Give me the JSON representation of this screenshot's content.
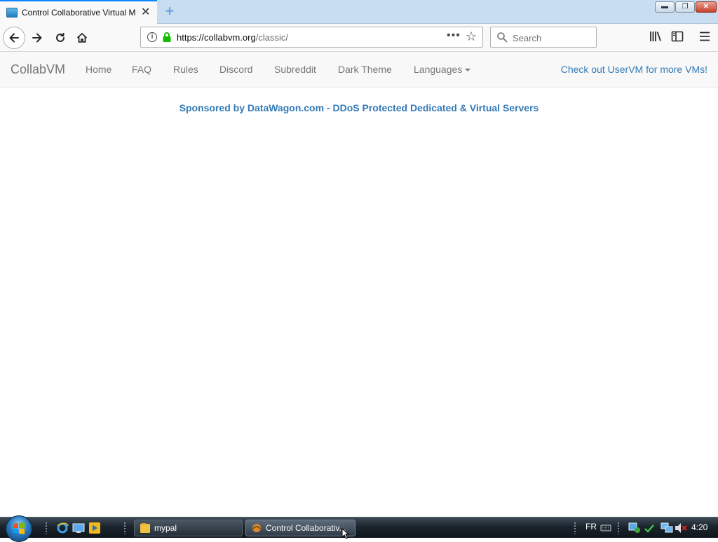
{
  "browser": {
    "tab_title": "Control Collaborative Virtual M",
    "new_tab_symbol": "+",
    "url_host": "https://collabvm.org",
    "url_path": "/classic/",
    "search_placeholder": "Search"
  },
  "window_controls": {
    "minimize": "▬",
    "maximize": "❐",
    "close": "✕"
  },
  "site_nav": {
    "brand": "CollabVM",
    "links": [
      "Home",
      "FAQ",
      "Rules",
      "Discord",
      "Subreddit",
      "Dark Theme",
      "Languages"
    ],
    "right_link": "Check out UserVM for more VMs!"
  },
  "sponsor_text": "Sponsored by DataWagon.com - DDoS Protected Dedicated & Virtual Servers",
  "taskbar": {
    "tasks": [
      {
        "label": "mypal"
      },
      {
        "label": "Control Collaborativ..."
      }
    ],
    "language": "FR",
    "clock": "4:20"
  },
  "colors": {
    "link_blue": "#337ab7",
    "nav_text": "#777777",
    "tab_accent": "#0a84ff"
  }
}
